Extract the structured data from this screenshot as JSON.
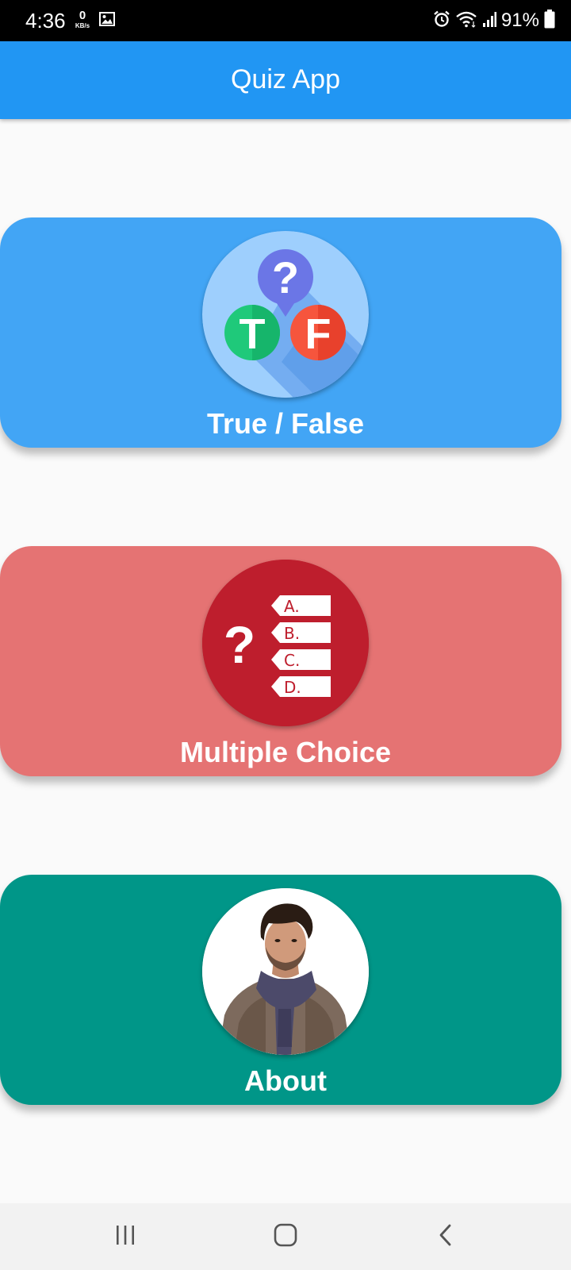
{
  "status_bar": {
    "time": "4:36",
    "network_speed": "0",
    "network_unit": "KB/s",
    "battery_percent": "91%",
    "icons": [
      "gallery-icon",
      "alarm-icon",
      "wifi-icon",
      "signal-icon",
      "battery-icon"
    ]
  },
  "app_bar": {
    "title": "Quiz App",
    "color": "#2196f3"
  },
  "cards": {
    "true_false": {
      "label": "True / False",
      "color": "#42a5f5",
      "icon_letters": {
        "question": "?",
        "true": "T",
        "false": "F"
      }
    },
    "multiple_choice": {
      "label": "Multiple Choice",
      "color": "#e57373",
      "icon_question": "?",
      "options": [
        "A.",
        "B.",
        "C.",
        "D."
      ]
    },
    "about": {
      "label": "About",
      "color": "#009688"
    }
  },
  "navigation_bar": {
    "buttons": [
      "recent-apps-icon",
      "home-icon",
      "back-icon"
    ]
  }
}
